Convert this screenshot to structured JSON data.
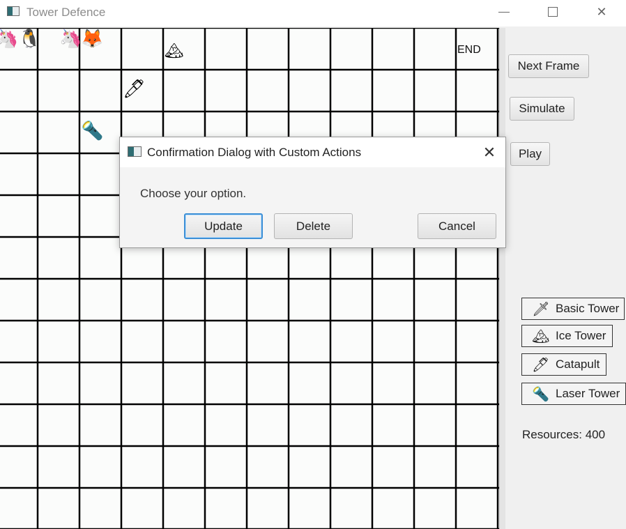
{
  "window": {
    "title": "Tower Defence",
    "minimize_icon": "minimize-icon",
    "maximize_icon": "maximize-icon",
    "close_icon": "close-icon"
  },
  "board": {
    "end_label": "END",
    "sprites": [
      {
        "name": "unicorn-enemy",
        "glyph": "🦄"
      },
      {
        "name": "penguin-enemy",
        "glyph": "🐧"
      },
      {
        "name": "unicorn-enemy",
        "glyph": "🦄"
      },
      {
        "name": "fox-enemy",
        "glyph": "🦊"
      },
      {
        "name": "ice-tower",
        "glyph": "🏔"
      },
      {
        "name": "catapult-tower",
        "glyph": "🖊"
      },
      {
        "name": "laser-tower",
        "glyph": "🔦"
      }
    ]
  },
  "controls": {
    "next_frame": "Next Frame",
    "simulate": "Simulate",
    "play": "Play"
  },
  "towers": [
    {
      "label": "Basic Tower",
      "icon": "🗡"
    },
    {
      "label": "Ice Tower",
      "icon": "🏔"
    },
    {
      "label": "Catapult",
      "icon": "🖊"
    },
    {
      "label": "Laser Tower",
      "icon": "🔦"
    }
  ],
  "resources_text": "Resources: 400",
  "dialog": {
    "title": "Confirmation Dialog with Custom Actions",
    "message": "Choose your option.",
    "buttons": {
      "update": "Update",
      "delete": "Delete",
      "cancel": "Cancel"
    }
  }
}
